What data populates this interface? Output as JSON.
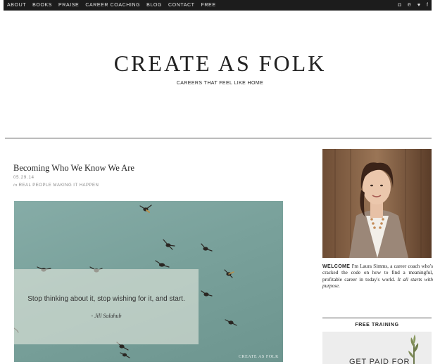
{
  "nav": {
    "links": [
      "ABOUT",
      "BOOKS",
      "PRAISE",
      "CAREER COACHING",
      "BLOG",
      "CONTACT",
      "FREE"
    ],
    "social_icons": [
      {
        "name": "instagram-icon",
        "glyph": "◘"
      },
      {
        "name": "pinterest-icon",
        "glyph": "℗"
      },
      {
        "name": "twitter-icon",
        "glyph": "♥"
      },
      {
        "name": "facebook-icon",
        "glyph": "f"
      }
    ]
  },
  "brand": {
    "title": "CREATE AS FOLK",
    "tagline": "CAREERS THAT FEEL LIKE HOME"
  },
  "post": {
    "title": "Becoming Who We Know We Are",
    "date": "05.29.14",
    "category_prefix": "in",
    "category": "REAL PEOPLE MAKING IT HAPPEN",
    "quote": "Stop thinking about it, stop wishing for it, and start.",
    "quote_author": "- Jill Salahub",
    "watermark": "CREATE AS FOLK"
  },
  "sidebar": {
    "welcome_label": "WELCOME",
    "welcome_text": "I'm Laura Simms, a career coach who's cracked the code on how to find a meaningful, profitable career in today's world.",
    "welcome_italic": "It all starts with purpose.",
    "free_training_heading": "FREE TRAINING",
    "ad_text": "GET PAID FOR"
  },
  "colors": {
    "nav_bg": "#1c1c1c",
    "hero_sky": "#7aa29c"
  }
}
